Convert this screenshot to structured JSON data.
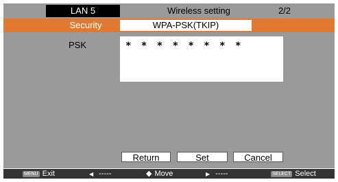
{
  "header": {
    "tab_label": "LAN 5",
    "title": "Wireless setting",
    "page": "2/2"
  },
  "security": {
    "label": "Security",
    "value": "WPA-PSK(TKIP)"
  },
  "psk": {
    "label": "PSK",
    "value": "* * * * * * * *"
  },
  "buttons": {
    "return": "Return",
    "set": "Set",
    "cancel": "Cancel"
  },
  "footer": {
    "exit_badge": "MENU",
    "exit_label": "Exit",
    "left_arrow": "◀",
    "left_value": "-----",
    "move_arrow": "◆",
    "move_label": "Move",
    "right_arrow": "▶",
    "right_value": "-----",
    "select_badge": "SELECT",
    "select_label": "Select"
  },
  "colors": {
    "accent": "#e07a32",
    "background": "#9a9a9a",
    "footer": "#333333"
  }
}
